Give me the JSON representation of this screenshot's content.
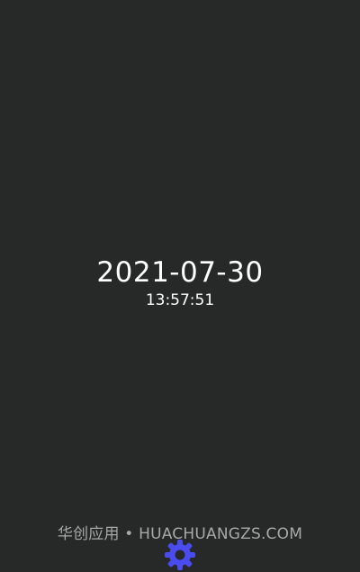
{
  "clock": {
    "date": "2021-07-30",
    "time": "13:57:51"
  },
  "footer": {
    "watermark": "华创应用 • HUACHUANGZS.COM",
    "settings_icon": "gear-icon"
  },
  "colors": {
    "background": "#272928",
    "text": "#ffffff",
    "watermark": "#a7a9a8",
    "accent": "#4b4cf0"
  }
}
